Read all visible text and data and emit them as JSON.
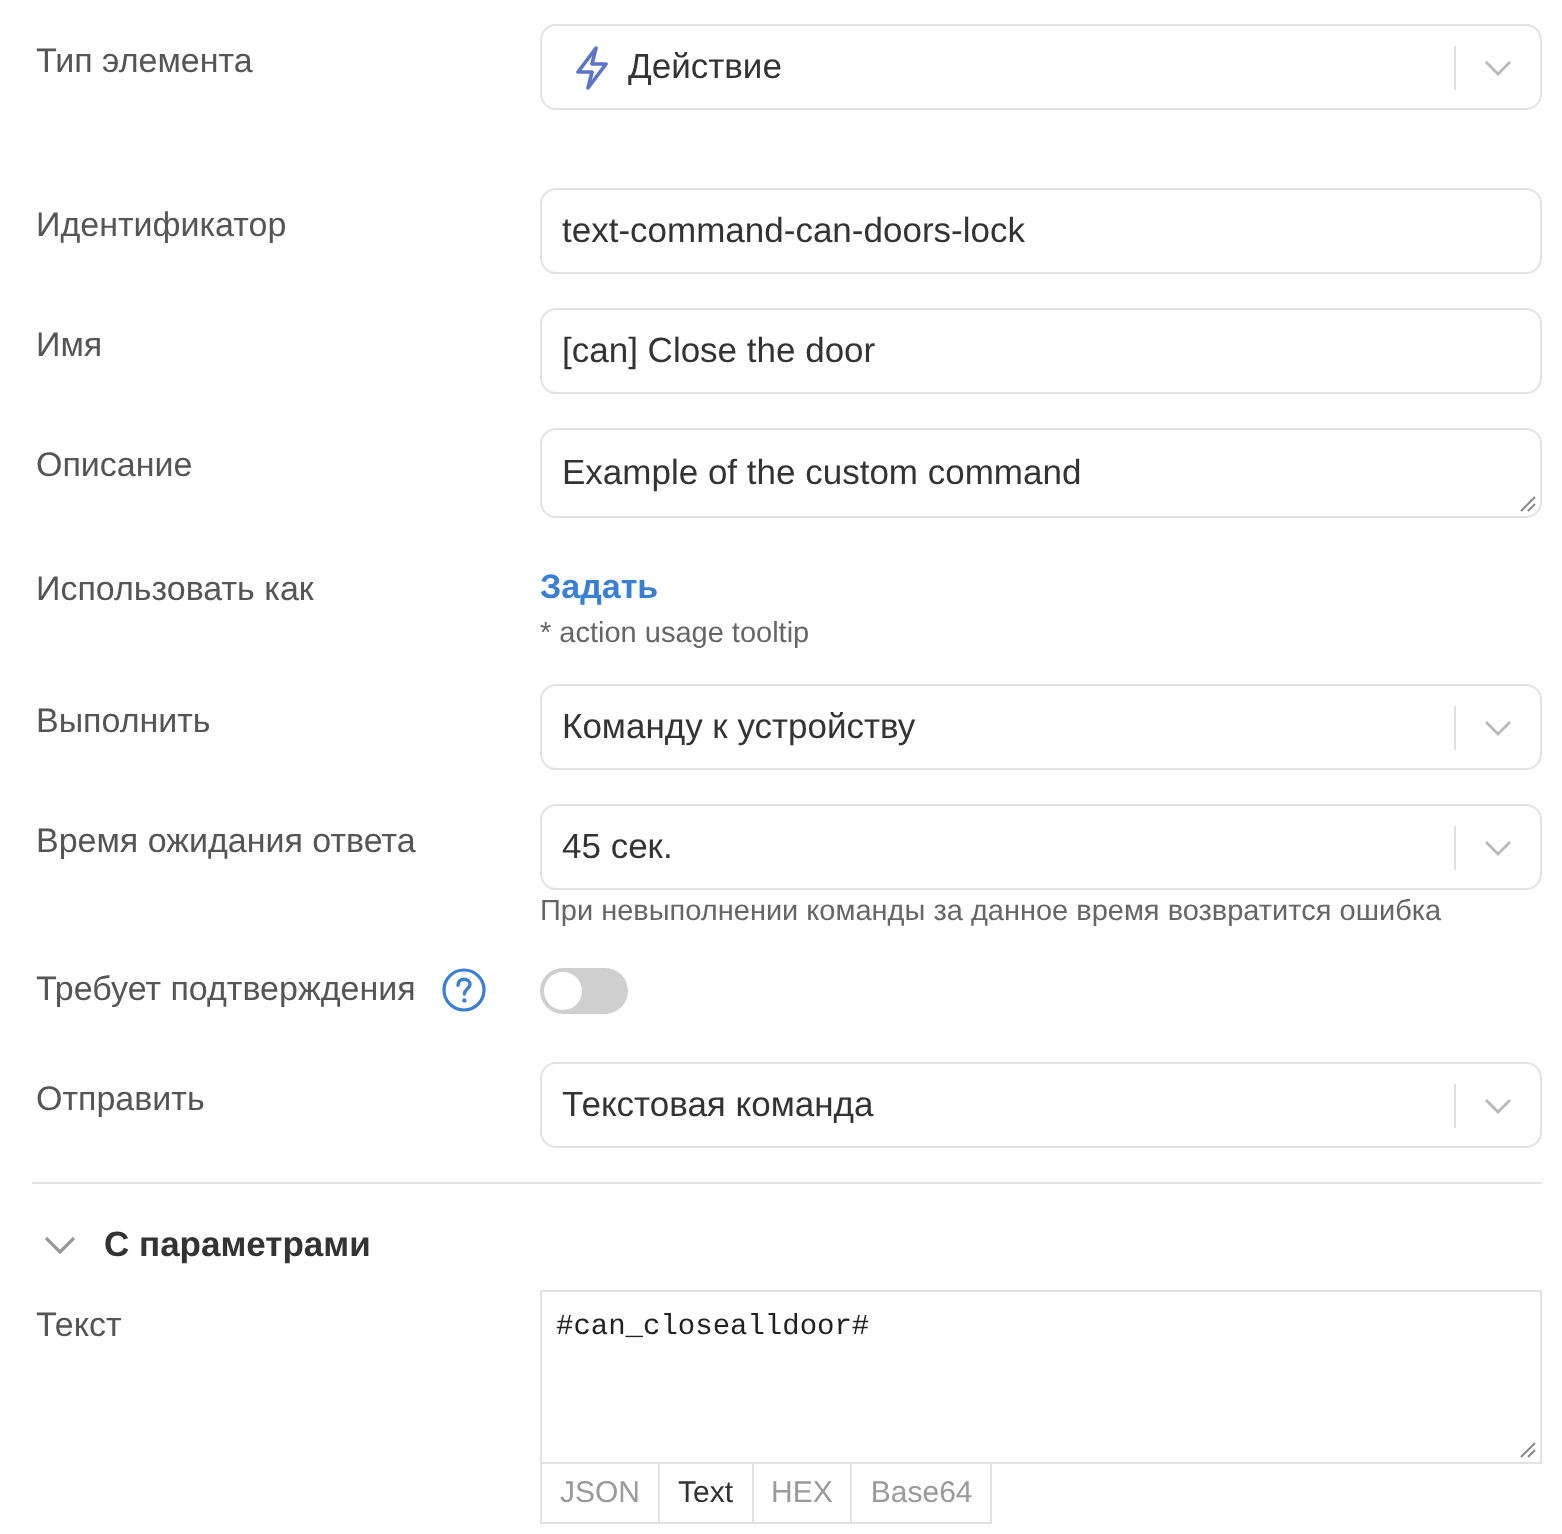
{
  "element_type": {
    "label": "Тип элемента",
    "value": "Действие"
  },
  "fields": [
    {
      "kind": "input",
      "label": "Идентификатор",
      "value": "text-command-can-doors-lock"
    },
    {
      "kind": "input",
      "label": "Имя",
      "value": "[can] Close the door"
    },
    {
      "kind": "textarea",
      "label": "Описание",
      "value": "Example of the custom command"
    },
    {
      "kind": "link",
      "label": "Использовать как",
      "value": "Задать",
      "hint": "* action usage tooltip"
    },
    {
      "kind": "select",
      "label": "Выполнить",
      "value": "Команду к устройству"
    },
    {
      "kind": "select",
      "label": "Время ожидания ответа",
      "value": "45 сек.",
      "hint": "При невыполнении команды за данное время возвратится ошибка"
    },
    {
      "kind": "toggle",
      "label": "Требует подтверждения",
      "on": false
    },
    {
      "kind": "select",
      "label": "Отправить",
      "value": "Текстовая команда"
    }
  ],
  "section": {
    "title": "С параметрами",
    "expanded": true,
    "fields": [
      {
        "kind": "code",
        "label": "Текст",
        "value": "#can_closealldoor#",
        "formats": [
          {
            "label": "JSON",
            "selected": false
          },
          {
            "label": "Text",
            "selected": true
          },
          {
            "label": "HEX",
            "selected": false
          },
          {
            "label": "Base64",
            "selected": false
          }
        ]
      }
    ]
  }
}
